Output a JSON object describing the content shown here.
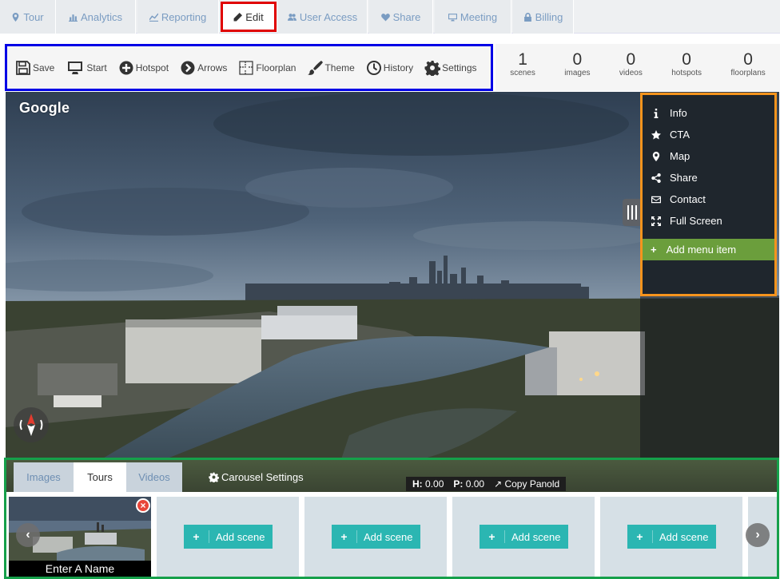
{
  "tabs": [
    {
      "label": "Tour",
      "icon": "map-marker-icon"
    },
    {
      "label": "Analytics",
      "icon": "bar-chart-icon"
    },
    {
      "label": "Reporting",
      "icon": "line-chart-icon"
    },
    {
      "label": "Edit",
      "icon": "pencil-icon",
      "active": true
    },
    {
      "label": "User Access",
      "icon": "users-icon"
    },
    {
      "label": "Share",
      "icon": "heart-icon"
    },
    {
      "label": "Meeting",
      "icon": "monitor-icon"
    },
    {
      "label": "Billing",
      "icon": "lock-icon"
    }
  ],
  "toolbar": [
    {
      "label": "Save",
      "icon": "save-icon"
    },
    {
      "label": "Start",
      "icon": "monitor-icon"
    },
    {
      "label": "Hotspot",
      "icon": "plus-circle-icon"
    },
    {
      "label": "Arrows",
      "icon": "arrow-circle-icon"
    },
    {
      "label": "Floorplan",
      "icon": "floorplan-icon"
    },
    {
      "label": "Theme",
      "icon": "brush-icon"
    },
    {
      "label": "History",
      "icon": "clock-icon"
    },
    {
      "label": "Settings",
      "icon": "gear-icon"
    }
  ],
  "stats": [
    {
      "value": "1",
      "label": "scenes"
    },
    {
      "value": "0",
      "label": "images"
    },
    {
      "value": "0",
      "label": "videos"
    },
    {
      "value": "0",
      "label": "hotspots"
    },
    {
      "value": "0",
      "label": "floorplans"
    }
  ],
  "viewer": {
    "watermark": "Google"
  },
  "side_menu": {
    "items": [
      {
        "label": "Info",
        "icon": "info-icon"
      },
      {
        "label": "CTA",
        "icon": "star-icon"
      },
      {
        "label": "Map",
        "icon": "map-marker-icon"
      },
      {
        "label": "Share",
        "icon": "share-icon"
      },
      {
        "label": "Contact",
        "icon": "envelope-icon"
      },
      {
        "label": "Full Screen",
        "icon": "fullscreen-icon"
      }
    ],
    "add_item": "Add menu item"
  },
  "carousel": {
    "tabs": [
      "Images",
      "Tours",
      "Videos"
    ],
    "active_tab": "Tours",
    "settings_label": "Carousel Settings",
    "h_label": "H:",
    "h_value": "0.00",
    "p_label": "P:",
    "p_value": "0.00",
    "copy_label": "Copy Panold",
    "scene_name": "Enter A Name",
    "add_scene_label": "Add scene",
    "colors": {
      "border": "#15a04a",
      "add_button": "#2bb6b2"
    }
  },
  "highlight_colors": {
    "tab": "#e00000",
    "toolbar": "#0000e6",
    "menu": "#f6941d",
    "carousel": "#15a04a"
  }
}
